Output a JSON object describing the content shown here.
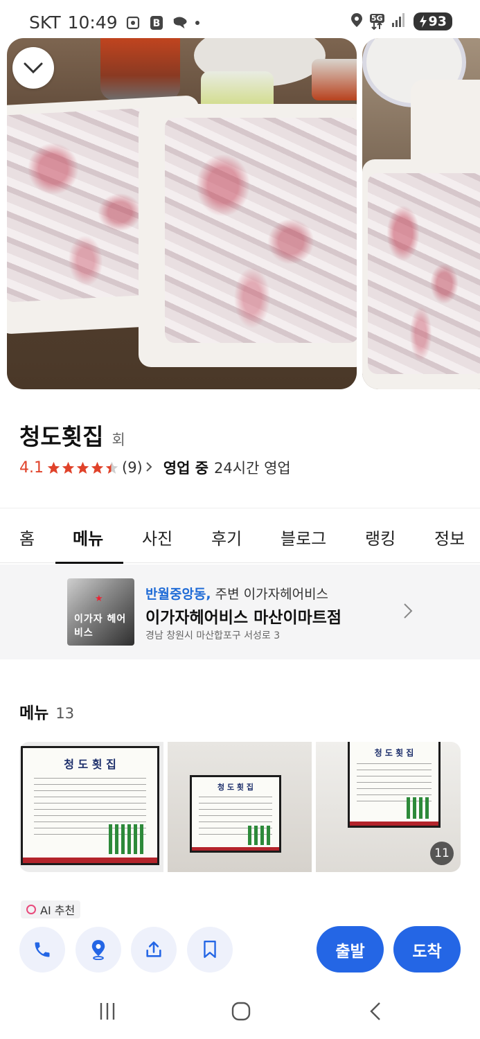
{
  "status_bar": {
    "carrier": "SKT",
    "time": "10:49",
    "network": "5G",
    "battery": "93"
  },
  "place": {
    "name": "청도횟집",
    "category": "회",
    "rating": "4.1",
    "review_count": "(9)",
    "open_status": "영업 중",
    "hours": "24시간 영업"
  },
  "tabs": [
    {
      "label": "홈"
    },
    {
      "label": "메뉴"
    },
    {
      "label": "사진"
    },
    {
      "label": "후기"
    },
    {
      "label": "블로그"
    },
    {
      "label": "랭킹"
    },
    {
      "label": "정보"
    }
  ],
  "active_tab": "메뉴",
  "ad": {
    "location": "반월중앙동,",
    "nearby": "주변 이가자헤어비스",
    "title": "이가자헤어비스 마산이마트점",
    "address": "경남 창원시 마산합포구 서성로 3",
    "thumb_logo": "이가자 헤어비스"
  },
  "menu_section": {
    "title": "메뉴",
    "count": "13",
    "board_title": "청 도 횟 집",
    "more_photos": "11"
  },
  "ai_badge": "AI 추천",
  "actions": {
    "call_icon": "phone-icon",
    "map_icon": "map-pin-icon",
    "share_icon": "share-icon",
    "save_icon": "bookmark-icon",
    "depart_label": "출발",
    "arrive_label": "도착"
  },
  "colors": {
    "accent": "#2466e5",
    "rating": "#e0422a",
    "star": "#e0422a",
    "link": "#1f6bd6"
  }
}
